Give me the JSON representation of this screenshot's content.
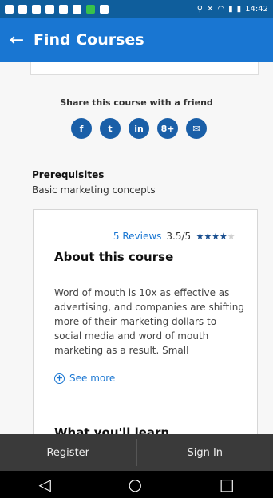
{
  "status": {
    "time": "14:42"
  },
  "appbar": {
    "title": "Find Courses"
  },
  "share": {
    "title": "Share this course with a friend",
    "icons": [
      "f",
      "t",
      "in",
      "8+",
      "✉"
    ]
  },
  "prereq": {
    "heading": "Prerequisites",
    "value": "Basic marketing concepts"
  },
  "course": {
    "reviews": "5 Reviews",
    "score": "3.5/5",
    "rating": 3.5,
    "about_title": "About this course",
    "description": "Word of mouth is 10x as effective as advertising, and companies are shifting more of their marketing dollars to social media and word of mouth marketing as a result. Small",
    "see_more": "See more",
    "learn_title": "What you'll learn"
  },
  "bottom": {
    "register": "Register",
    "signin": "Sign In"
  }
}
